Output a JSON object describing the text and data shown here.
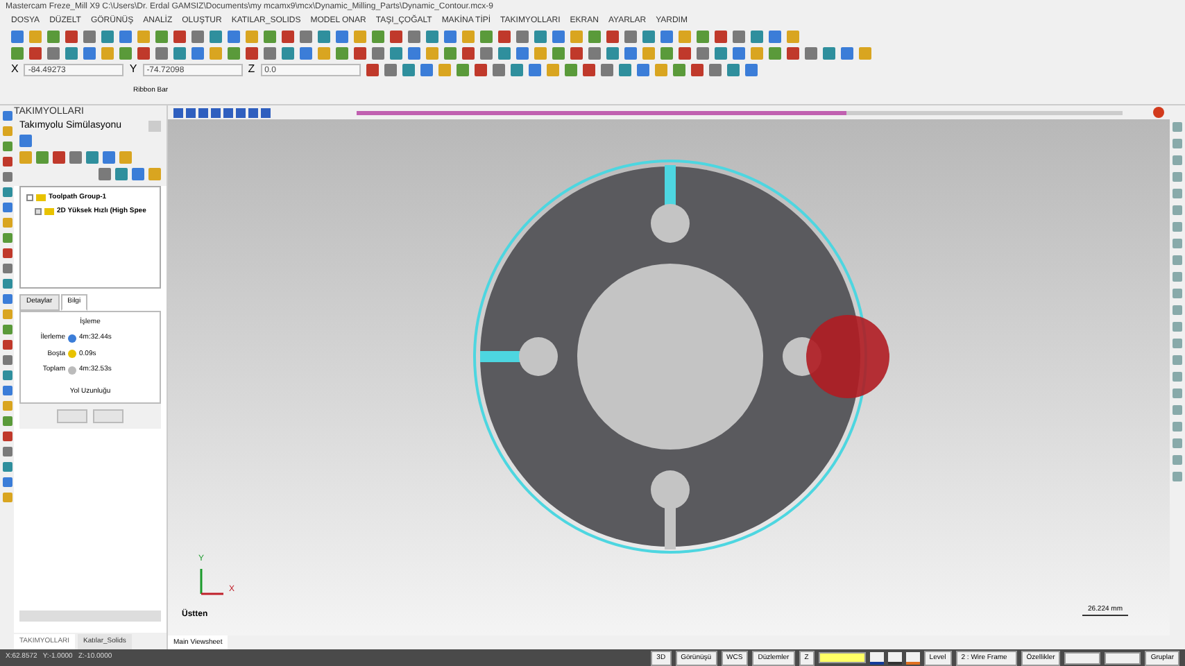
{
  "window": {
    "title": "Mastercam Freze_Mill X9  C:\\Users\\Dr. Erdal GAMSIZ\\Documents\\my mcamx9\\mcx\\Dynamic_Milling_Parts\\Dynamic_Contour.mcx-9"
  },
  "menu": [
    "DOSYA",
    "DÜZELT",
    "GÖRÜNÜŞ",
    "ANALİZ",
    "OLUŞTUR",
    "KATILAR_SOLIDS",
    "MODEL ONAR",
    "TAŞI_ÇOĞALT",
    "MAKİNA TİPİ",
    "TAKIMYOLLARI",
    "EKRAN",
    "AYARLAR",
    "YARDIM"
  ],
  "coordinates": [
    {
      "label": "X",
      "value": "-84.49273"
    },
    {
      "label": "Y",
      "value": "-74.72098"
    },
    {
      "label": "Z",
      "value": "0.0"
    }
  ],
  "ribbon_bar": "Ribbon Bar",
  "panel": {
    "header": "TAKIMYOLLARI",
    "title": "Takımyolu Simülasyonu",
    "tree": [
      {
        "label": "Toolpath Group-1",
        "expanded": true,
        "children": [
          {
            "label": "2D Yüksek Hızlı (High Spee",
            "expanded": false
          }
        ]
      }
    ],
    "tabs": [
      {
        "label": "Detaylar",
        "selected": false
      },
      {
        "label": "Bilgi",
        "selected": true
      }
    ],
    "info": {
      "heading": "İşleme",
      "rows": [
        {
          "label": "İlerleme",
          "value": "4m:32.44s"
        },
        {
          "label": "Boşta",
          "value": "0.09s"
        },
        {
          "label": "Toplam",
          "value": "4m:32.53s"
        }
      ],
      "footer": "Yol Uzunluğu"
    }
  },
  "playback": {
    "level": 0.64
  },
  "viewport": {
    "view": "Üstten",
    "axis_x": "X",
    "axis_y": "Y",
    "scale": "26.224 mm",
    "tab": "Main Viewsheet"
  },
  "bottom_tabs": [
    {
      "label": "TAKIMYOLLARI",
      "selected": true
    },
    {
      "label": "Katılar_Solids",
      "selected": false
    }
  ],
  "status_bar": {
    "coords": "X:62.8572   Y:-1.0000   Z:-10.0000",
    "buttons": [
      "3D",
      "Görünüşü",
      "WCS",
      "Düzlemler"
    ],
    "z": "Z",
    "level_label": "Level",
    "level_value": "2 : Wire Frame",
    "attributes": "Özellikler",
    "groups": "Gruplar"
  }
}
